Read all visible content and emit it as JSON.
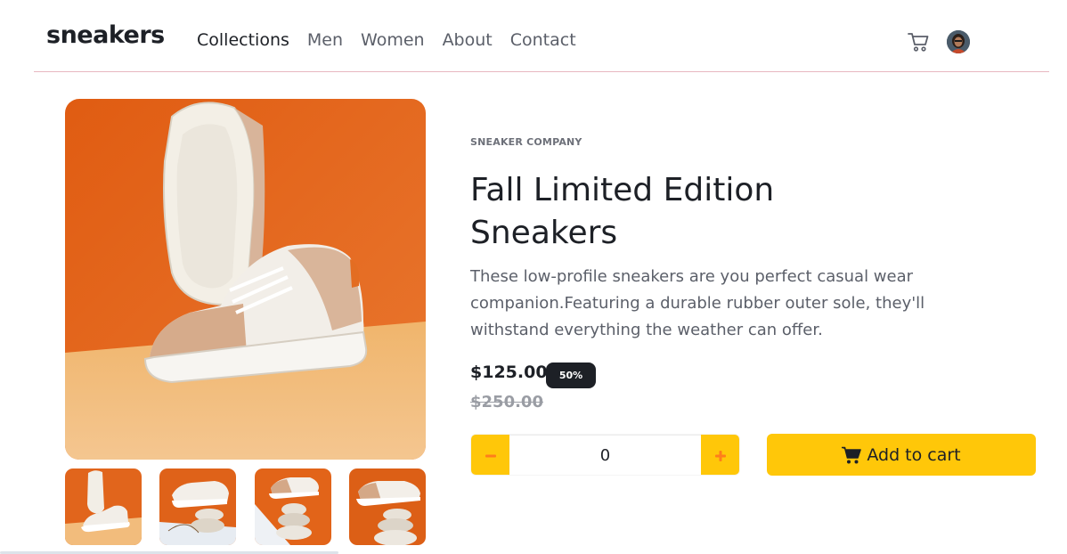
{
  "header": {
    "logo": "sneakers",
    "nav": [
      "Collections",
      "Men",
      "Women",
      "About",
      "Contact"
    ],
    "active_nav": "Collections"
  },
  "product": {
    "company": "SNEAKER COMPANY",
    "title": "Fall Limited Edition Sneakers",
    "description": "These low-profile sneakers are you perfect casual wear companion.Featuring a durable rubber outer sole, they'll withstand everything the weather can offer.",
    "price": "$125.00",
    "discount": "50%",
    "old_price": "$250.00"
  },
  "cart": {
    "quantity": "0",
    "add_label": "Add to cart"
  },
  "colors": {
    "accent": "#ffc709",
    "accent_icon": "#ff7e1b",
    "dark": "#1d2026",
    "muted": "#5b5f69",
    "header_border": "#e8b7c0"
  },
  "icons": {
    "cart": "cart-icon",
    "minus": "minus-icon",
    "plus": "plus-icon",
    "avatar": "avatar"
  }
}
